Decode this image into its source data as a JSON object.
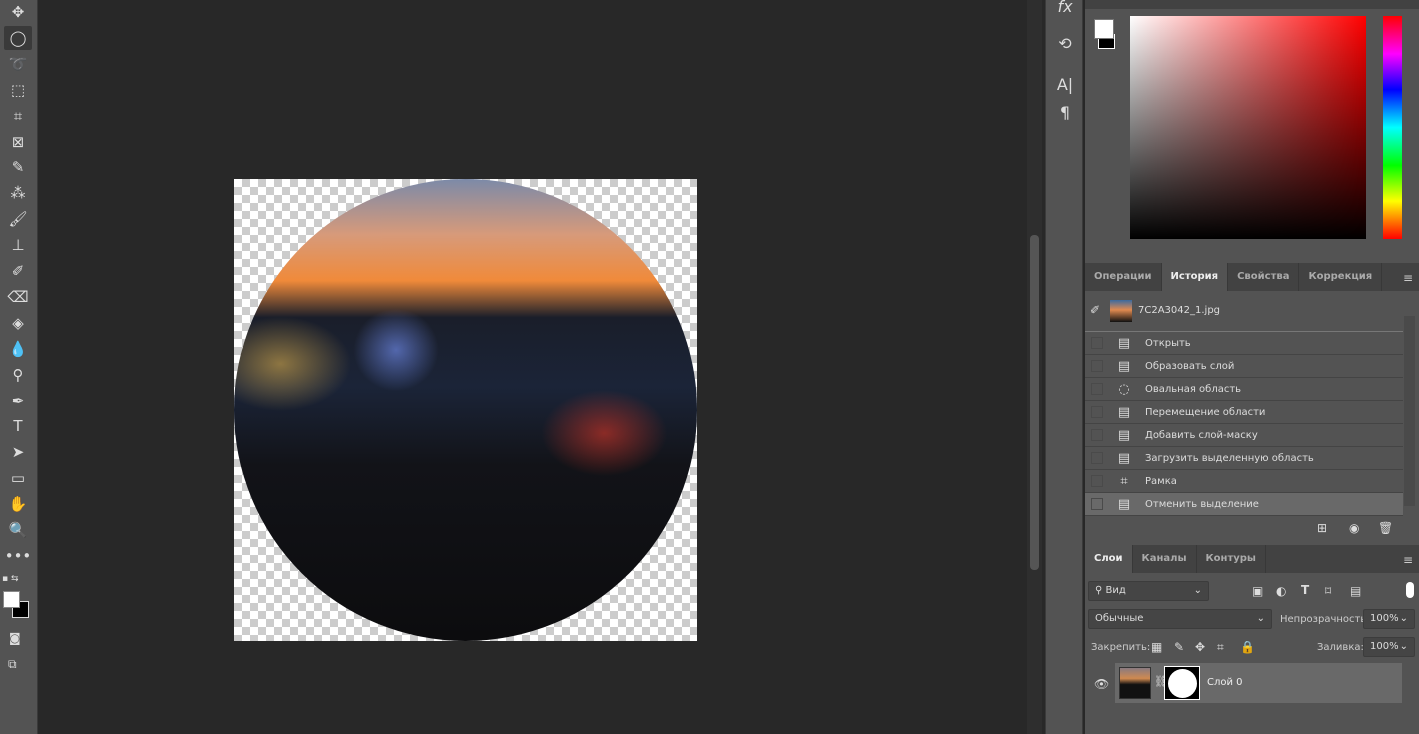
{
  "toolbar": {
    "tools": [
      "move-icon",
      "elliptical-marquee-icon",
      "lasso-icon",
      "object-select-icon",
      "crop-icon",
      "frame-icon",
      "eyedropper-icon",
      "healing-brush-icon",
      "brush-icon",
      "stamp-icon",
      "history-brush-icon",
      "eraser-icon",
      "paint-bucket-icon",
      "blur-icon",
      "dodge-icon",
      "pen-icon",
      "type-icon",
      "path-select-icon",
      "rectangle-icon",
      "hand-icon",
      "zoom-icon",
      "more-icon"
    ],
    "glyphs": [
      "✥",
      "◯",
      "➰",
      "⬚",
      "⌗",
      "⊠",
      "✎",
      "⁂",
      "🖌",
      "⊥",
      "✐",
      "⌫",
      "◈",
      "💧",
      "⚲",
      "✒",
      "T",
      "➤",
      "▭",
      "✋",
      "🔍",
      "•••"
    ]
  },
  "mini_panel": {
    "fx": "fx",
    "glyph_type": "A|",
    "glyph_para": "¶"
  },
  "colors": {
    "foreground": "#ffffff",
    "background": "#000000",
    "hue": "#ff0000"
  },
  "history_panel": {
    "tabs": [
      "Операции",
      "История",
      "Свойства",
      "Коррекция"
    ],
    "active_tab": 1,
    "snapshot": "7C2A3042_1.jpg",
    "items": [
      {
        "label": "Открыть",
        "icon": "document-icon"
      },
      {
        "label": "Образовать слой",
        "icon": "document-icon"
      },
      {
        "label": "Овальная область",
        "icon": "ellipse-select-icon"
      },
      {
        "label": "Перемещение области",
        "icon": "document-icon"
      },
      {
        "label": "Добавить слой-маску",
        "icon": "document-icon"
      },
      {
        "label": "Загрузить выделенную область",
        "icon": "document-icon"
      },
      {
        "label": "Рамка",
        "icon": "crop-icon"
      },
      {
        "label": "Отменить выделение",
        "icon": "document-icon"
      }
    ],
    "selected": 7
  },
  "layers_panel": {
    "tabs": [
      "Слои",
      "Каналы",
      "Контуры"
    ],
    "filter": "Вид",
    "blend_mode": "Обычные",
    "opacity_label": "Непрозрачность:",
    "opacity": "100%",
    "lock_label": "Закрепить:",
    "fill_label": "Заливка:",
    "fill": "100%",
    "layers": [
      {
        "name": "Слой 0",
        "visible": true
      }
    ]
  }
}
